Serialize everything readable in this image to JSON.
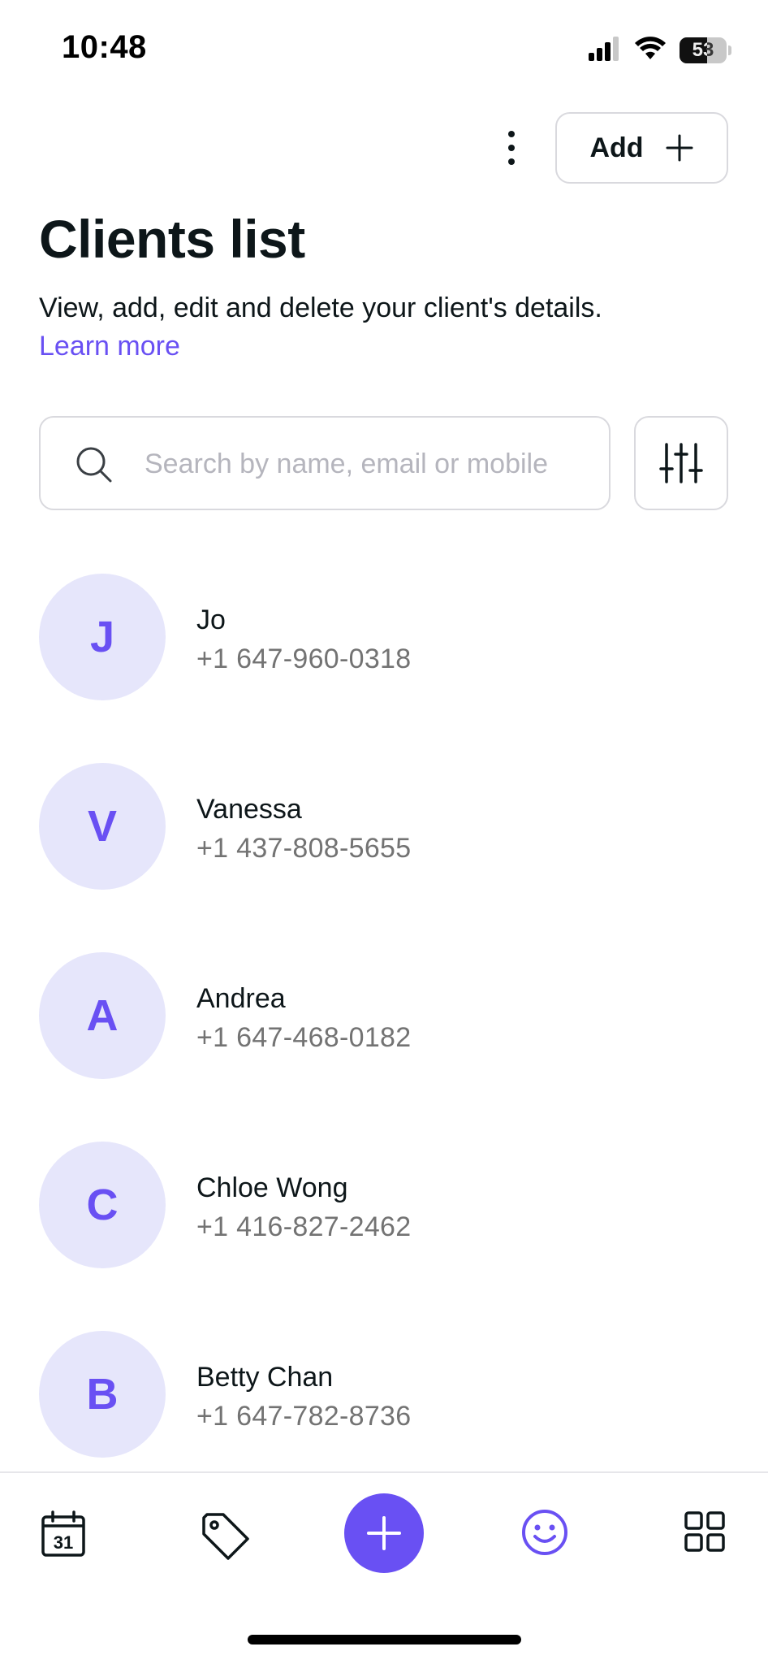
{
  "status_bar": {
    "time": "10:48",
    "battery_level": "53",
    "icons": [
      "cellular-signal-icon",
      "wifi-icon",
      "battery-icon"
    ]
  },
  "header": {
    "add_label": "Add",
    "title": "Clients list",
    "description": "View, add, edit and delete your client's details.",
    "learn_more": "Learn more"
  },
  "search": {
    "placeholder": "Search by name, email or mobile",
    "value": ""
  },
  "clients": [
    {
      "initial": "J",
      "name": "Jo",
      "phone": "+1 647-960-0318"
    },
    {
      "initial": "V",
      "name": "Vanessa",
      "phone": "+1 437-808-5655"
    },
    {
      "initial": "A",
      "name": "Andrea",
      "phone": "+1 647-468-0182"
    },
    {
      "initial": "C",
      "name": "Chloe Wong",
      "phone": "+1 416-827-2462"
    },
    {
      "initial": "B",
      "name": "Betty Chan",
      "phone": "+1 647-782-8736"
    }
  ],
  "bottom_nav": {
    "calendar_day": "31",
    "items": [
      "calendar-icon",
      "tag-icon",
      "add-icon",
      "smiley-icon",
      "grid-icon"
    ],
    "active": "smiley-icon"
  },
  "colors": {
    "accent": "#6950f3",
    "avatar_bg": "#e6e6fb",
    "text": "#0d1619",
    "muted": "#737373",
    "border": "#d9d9de"
  }
}
